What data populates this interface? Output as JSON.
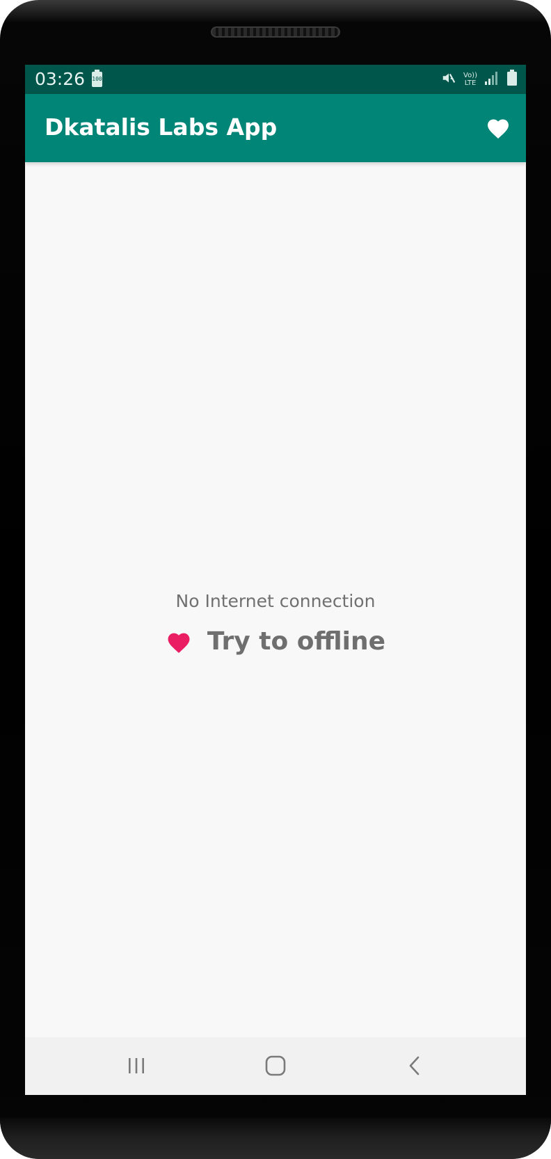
{
  "status_bar": {
    "time": "03:26",
    "battery_small_label": "100",
    "network_label_top": "Vo))",
    "network_label_bottom": "LTE",
    "icons": [
      "battery-icon",
      "mute-icon",
      "volte-icon",
      "signal-icon",
      "battery-full-icon"
    ]
  },
  "app_bar": {
    "title": "Dkatalis Labs App",
    "action_icon": "heart-icon"
  },
  "content": {
    "message": "No Internet connection",
    "offline_button_label": "Try to offline",
    "offline_icon": "heart-icon"
  },
  "nav_bar": {
    "buttons": [
      "recents-icon",
      "home-icon",
      "back-icon"
    ]
  },
  "colors": {
    "status_bar": "#00564a",
    "app_bar": "#008577",
    "accent_heart": "#e91e63",
    "background": "#f8f8f8",
    "text_gray": "#707070"
  }
}
